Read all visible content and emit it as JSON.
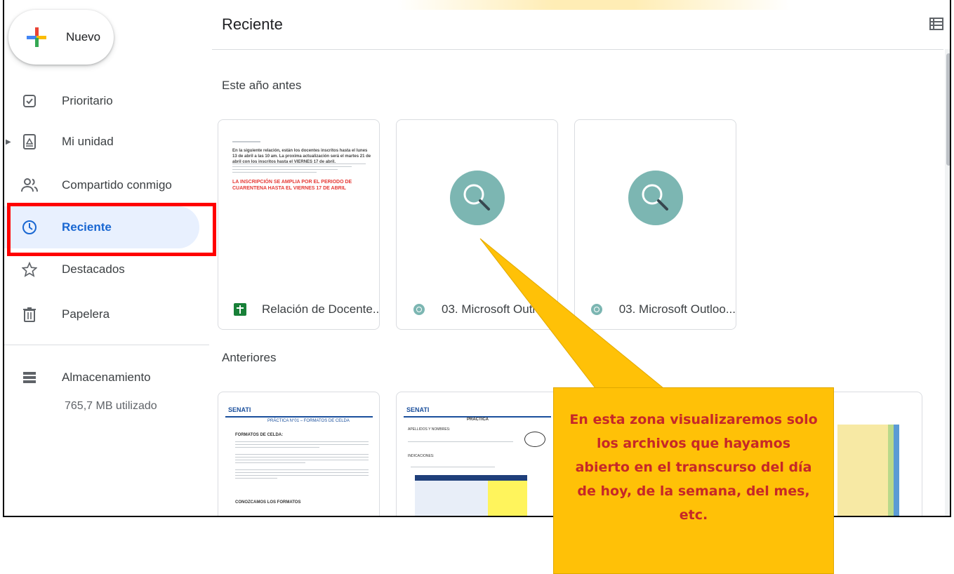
{
  "sidebar": {
    "new_label": "Nuevo",
    "items": [
      {
        "label": "Prioritario",
        "icon": "check-box-icon"
      },
      {
        "label": "Mi unidad",
        "icon": "drive-icon"
      },
      {
        "label": "Compartido conmigo",
        "icon": "people-icon"
      },
      {
        "label": "Reciente",
        "icon": "clock-icon",
        "active": true
      },
      {
        "label": "Destacados",
        "icon": "star-icon"
      },
      {
        "label": "Papelera",
        "icon": "trash-icon"
      }
    ],
    "storage_label": "Almacenamiento",
    "storage_used": "765,7 MB utilizado"
  },
  "main": {
    "title": "Reciente",
    "section1": "Este año antes",
    "section2": "Anteriores",
    "cards": [
      {
        "name": "Relación de Docente...",
        "icon": "sheets-icon"
      },
      {
        "name": "03. Microsoft Outlo...",
        "icon": "image-icon"
      },
      {
        "name": "03. Microsoft Outloo...",
        "icon": "image-icon"
      }
    ],
    "doc_preview": {
      "red_text": "LA INSCRIPCIÓN SE AMPLIA POR EL PERIODO DE CUARENTENA HASTA EL VIERNES 17 DE ABRIL",
      "line1": "En la siguiente relación, están los docentes inscritos hasta el lunes 13 de abril a las 10 am. La proxima actualización será el martes 21 de abril con los inscritos hasta el VIERNES 17 de abril."
    },
    "older_previews": {
      "senati": "SENATI",
      "practica1_title": "PRÁCTICA N°01 – FORMATOS DE CELDA",
      "formatos": "FORMATOS DE CELDA:",
      "conozcamos": "CONOZCAMOS LOS FORMATOS",
      "practica2_title": "PRÁCTICA",
      "apellidos": "APELLIDOS Y NOMBRES:",
      "indicaciones": "INDICACIONES:"
    }
  },
  "callout": {
    "text": "En esta zona visualizaremos solo los archivos que hayamos abierto en el transcurso del día de hoy, de la semana, del mes, etc."
  },
  "colors": {
    "accent": "#1967d2",
    "highlight": "#ff0000",
    "callout_bg": "#ffc107",
    "callout_text": "#c62828"
  }
}
